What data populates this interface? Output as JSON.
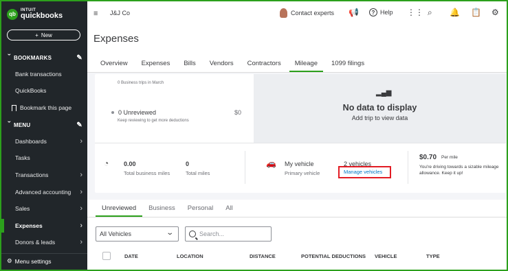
{
  "sidebar": {
    "logo_badge": "qb",
    "logo_line1": "INTUIT",
    "logo_line2": "quickbooks",
    "new_label": "New",
    "bookmarks_header": "BOOKMARKS",
    "bookmarks": [
      "Bank transactions",
      "QuickBooks",
      "Bookmark this page"
    ],
    "menu_header": "MENU",
    "menu_items": [
      "Dashboards",
      "Tasks",
      "Transactions",
      "Advanced accounting",
      "Sales",
      "Expenses",
      "Donors & leads"
    ],
    "active_item": "Expenses",
    "menu_settings": "Menu settings"
  },
  "topbar": {
    "company": "J&J Co",
    "contact": "Contact experts",
    "help": "Help"
  },
  "page": {
    "title": "Expenses",
    "tabs": [
      "Overview",
      "Expenses",
      "Bills",
      "Vendors",
      "Contractors",
      "Mileage",
      "1099 filings"
    ],
    "active_tab": "Mileage"
  },
  "mileage": {
    "trips_note": "0 Business trips in March",
    "unreviewed_label": "0 Unreviewed",
    "unreviewed_amount": "$0",
    "unreviewed_note": "Keep reviewing to get more deductions",
    "nodata_title": "No data to display",
    "nodata_sub": "Add trip to view data",
    "business_miles_value": "0.00",
    "business_miles_label": "Total business miles",
    "total_miles_value": "0",
    "total_miles_label": "Total miles",
    "vehicle_title": "My vehicle",
    "vehicle_sub": "Primary vehicle",
    "vehicles_count": "2 vehicles",
    "manage_vehicles": "Manage vehicles",
    "rate_value": "$0.70",
    "rate_unit": "Per mile",
    "rate_desc": "You're driving towards a sizable mileage allowance. Keep it up!"
  },
  "trips": {
    "tabs": [
      "Unreviewed",
      "Business",
      "Personal",
      "All"
    ],
    "active_tab": "Unreviewed",
    "vehicle_filter": "All Vehicles",
    "search_placeholder": "Search...",
    "columns": [
      "DATE",
      "LOCATION",
      "DISTANCE",
      "POTENTIAL DEDUCTIONS",
      "VEHICLE",
      "TYPE"
    ]
  },
  "colors": {
    "brand_green": "#2ca01c",
    "sidebar_bg": "#21262a",
    "link_blue": "#0077c5",
    "highlight_red": "#e21b23"
  }
}
